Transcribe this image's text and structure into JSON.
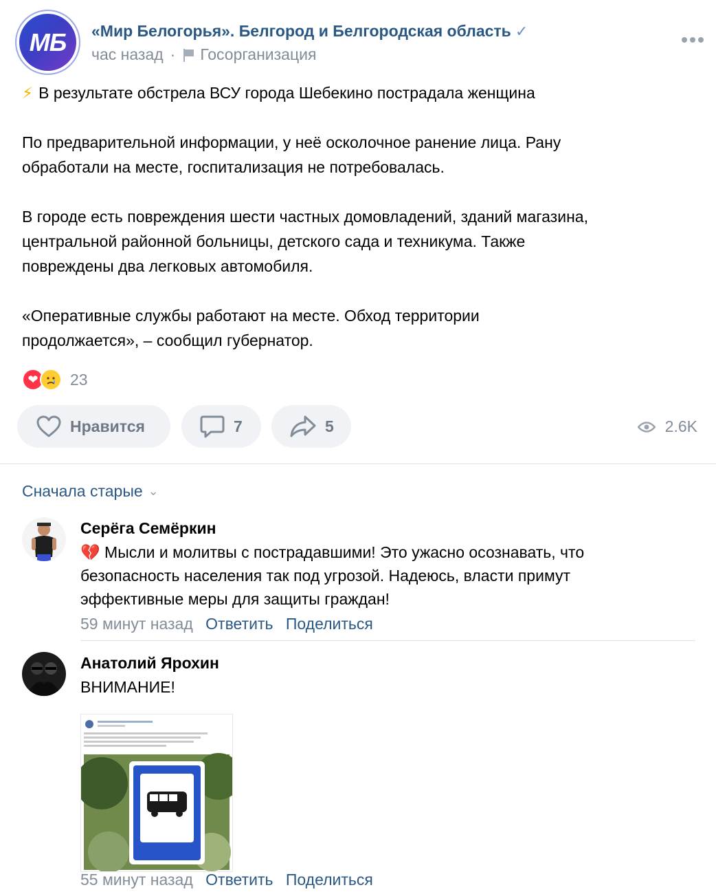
{
  "post": {
    "group_avatar_text": "МБ",
    "group_name": "«Мир Белогорья». Белгород и Белгородская область",
    "time": "час назад",
    "separator": "·",
    "org_type": "Госорганизация",
    "headline_emoji": "⚡",
    "headline": "В результате обстрела ВСУ города Шебекино пострадала женщина",
    "para1_line1": "По предварительной информации, у неё осколочное ранение лица. Рану",
    "para1_line2": "обработали на месте, госпитализация не потребовалась.",
    "para2_line1": "В городе есть повреждения шести частных домовладений, зданий магазина,",
    "para2_line2": "центральной районной больницы, детского сада и техникума. Также",
    "para2_line3": "повреждены два легковых автомобиля.",
    "para3_line1": "«Оперативные службы работают на месте. Обход территории",
    "para3_line2": "продолжается», – сообщил губернатор.",
    "reactions_count": "23",
    "like_label": "Нравится",
    "comments_count": "7",
    "shares_count": "5",
    "views": "2.6K"
  },
  "comments_section": {
    "sort_label": "Сначала старые"
  },
  "comments": [
    {
      "author": "Серёга Семёркин",
      "emoji": "💔",
      "line1": "Мысли и молитвы с пострадавшими! Это ужасно осознавать, что",
      "line2": "безопасность населения так под угрозой. Надеюсь, власти примут",
      "line3": "эффективные меры для защиты граждан!",
      "time": "59 минут назад",
      "reply": "Ответить",
      "share": "Поделиться"
    },
    {
      "author": "Анатолий Ярохин",
      "text": "ВНИМАНИЕ!",
      "time": "55 минут назад",
      "reply": "Ответить",
      "share": "Поделиться"
    }
  ],
  "colors": {
    "link": "#2a5885",
    "muted": "#818c99",
    "button_bg": "#f0f2f5"
  }
}
